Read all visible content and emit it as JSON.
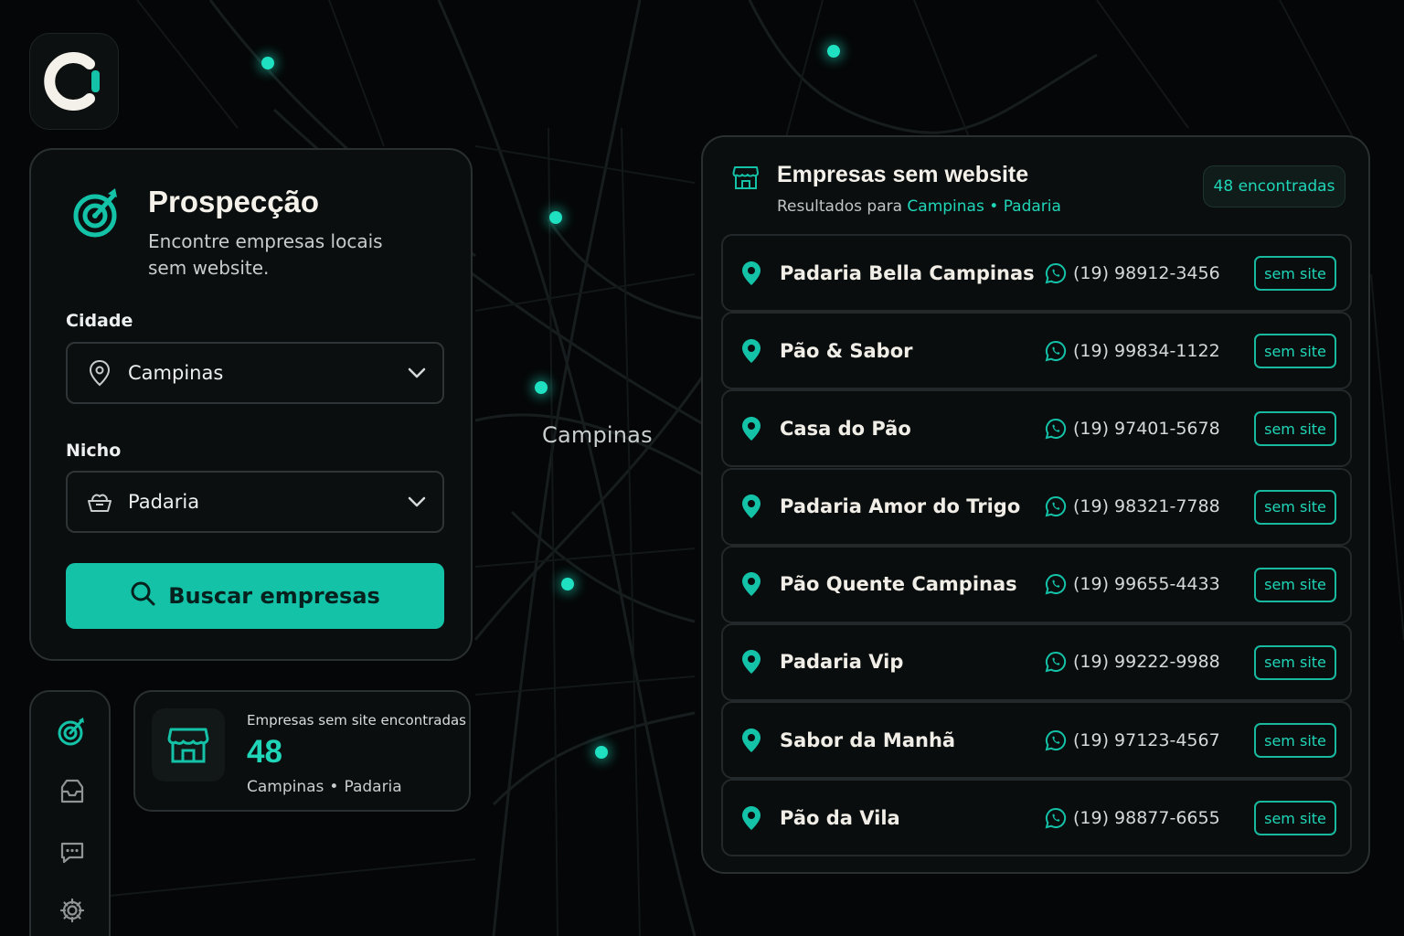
{
  "app": {
    "logo": "C-logo"
  },
  "map": {
    "city_label": "Campinas"
  },
  "prospeccao": {
    "title": "Prospecção",
    "subtitle": "Encontre empresas locais sem website.",
    "cidade_label": "Cidade",
    "cidade_value": "Campinas",
    "nicho_label": "Nicho",
    "nicho_value": "Padaria",
    "search_button": "Buscar empresas"
  },
  "sidebar": {
    "items": [
      {
        "icon": "target-icon"
      },
      {
        "icon": "inbox-icon"
      },
      {
        "icon": "chat-icon"
      },
      {
        "icon": "gear-icon"
      }
    ]
  },
  "stats": {
    "label": "Empresas sem site encontradas",
    "count": "48",
    "city": "Campinas",
    "sep": "•",
    "niche": "Padaria"
  },
  "results": {
    "title": "Empresas sem website",
    "subtitle_prefix": "Resultados para",
    "subtitle_city": "Campinas",
    "subtitle_sep": "•",
    "subtitle_niche": "Padaria",
    "count_badge": "48 encontradas",
    "items": [
      {
        "name": "Padaria Bella Campinas",
        "phone": "(19) 98912-3456",
        "tag": "sem site"
      },
      {
        "name": "Pão & Sabor",
        "phone": "(19) 99834-1122",
        "tag": "sem site"
      },
      {
        "name": "Casa do Pão",
        "phone": "(19) 97401-5678",
        "tag": "sem site"
      },
      {
        "name": "Padaria Amor do Trigo",
        "phone": "(19) 98321-7788",
        "tag": "sem site"
      },
      {
        "name": "Pão Quente Campinas",
        "phone": "(19) 99655-4433",
        "tag": "sem site"
      },
      {
        "name": "Padaria Vip",
        "phone": "(19) 99222-9988",
        "tag": "sem site"
      },
      {
        "name": "Sabor da Manhã",
        "phone": "(19) 97123-4567",
        "tag": "sem site"
      },
      {
        "name": "Pão da Vila",
        "phone": "(19) 98877-6655",
        "tag": "sem site"
      }
    ]
  },
  "colors": {
    "accent": "#14C2A8",
    "accent_text": "#1FD6B8",
    "background": "#050607"
  }
}
